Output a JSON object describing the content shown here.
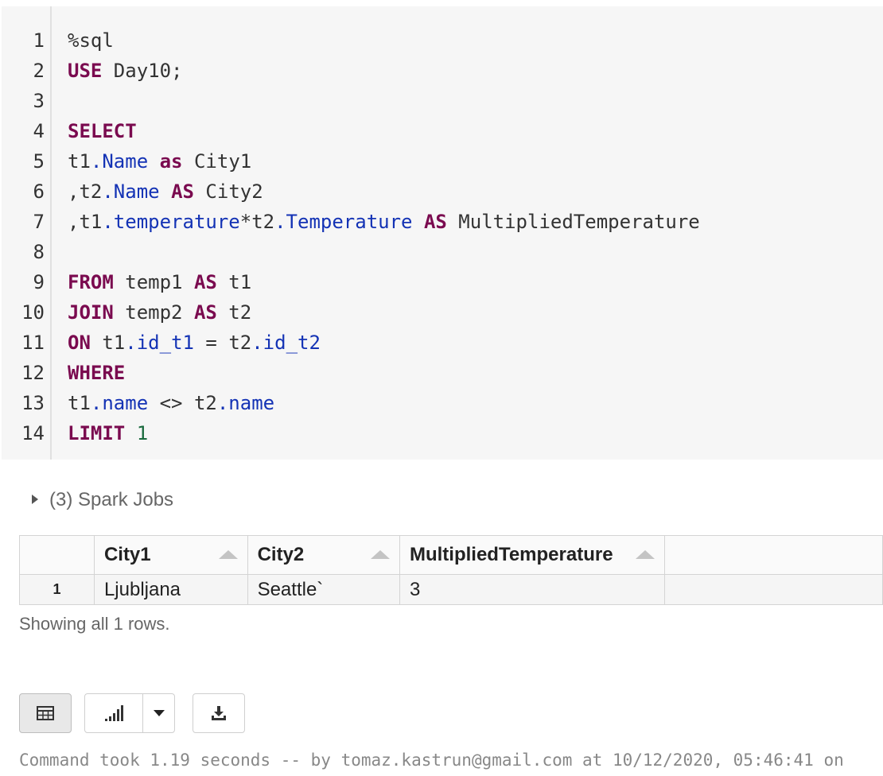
{
  "editor": {
    "lines": [
      {
        "num": "1",
        "tokens": [
          {
            "t": "%sql",
            "c": "plain"
          }
        ]
      },
      {
        "num": "2",
        "tokens": [
          {
            "t": "USE",
            "c": "kw"
          },
          {
            "t": " Day10;",
            "c": "plain"
          }
        ]
      },
      {
        "num": "3",
        "tokens": []
      },
      {
        "num": "4",
        "tokens": [
          {
            "t": "SELECT",
            "c": "kw"
          }
        ]
      },
      {
        "num": "5",
        "tokens": [
          {
            "t": "t1",
            "c": "plain"
          },
          {
            "t": ".Name",
            "c": "prop"
          },
          {
            "t": " ",
            "c": "plain"
          },
          {
            "t": "as",
            "c": "kw"
          },
          {
            "t": " City1",
            "c": "plain"
          }
        ]
      },
      {
        "num": "6",
        "tokens": [
          {
            "t": ",t2",
            "c": "plain"
          },
          {
            "t": ".Name",
            "c": "prop"
          },
          {
            "t": " ",
            "c": "plain"
          },
          {
            "t": "AS",
            "c": "kw"
          },
          {
            "t": " City2",
            "c": "plain"
          }
        ]
      },
      {
        "num": "7",
        "tokens": [
          {
            "t": ",t1",
            "c": "plain"
          },
          {
            "t": ".temperature",
            "c": "prop"
          },
          {
            "t": "*t2",
            "c": "plain"
          },
          {
            "t": ".Temperature",
            "c": "prop"
          },
          {
            "t": " ",
            "c": "plain"
          },
          {
            "t": "AS",
            "c": "kw"
          },
          {
            "t": " MultipliedTemperature",
            "c": "plain"
          }
        ]
      },
      {
        "num": "8",
        "tokens": []
      },
      {
        "num": "9",
        "tokens": [
          {
            "t": "FROM",
            "c": "kw"
          },
          {
            "t": " temp1 ",
            "c": "plain"
          },
          {
            "t": "AS",
            "c": "kw"
          },
          {
            "t": " t1",
            "c": "plain"
          }
        ]
      },
      {
        "num": "10",
        "tokens": [
          {
            "t": "JOIN",
            "c": "kw"
          },
          {
            "t": " temp2 ",
            "c": "plain"
          },
          {
            "t": "AS",
            "c": "kw"
          },
          {
            "t": " t2",
            "c": "plain"
          }
        ]
      },
      {
        "num": "11",
        "tokens": [
          {
            "t": "ON",
            "c": "kw"
          },
          {
            "t": " t1",
            "c": "plain"
          },
          {
            "t": ".id_t1",
            "c": "prop"
          },
          {
            "t": " = t2",
            "c": "plain"
          },
          {
            "t": ".id_t2",
            "c": "prop"
          }
        ]
      },
      {
        "num": "12",
        "tokens": [
          {
            "t": "WHERE",
            "c": "kw"
          }
        ]
      },
      {
        "num": "13",
        "tokens": [
          {
            "t": "t1",
            "c": "plain"
          },
          {
            "t": ".name",
            "c": "prop"
          },
          {
            "t": " <> t2",
            "c": "plain"
          },
          {
            "t": ".name",
            "c": "prop"
          }
        ]
      },
      {
        "num": "14",
        "tokens": [
          {
            "t": "LIMIT",
            "c": "kw"
          },
          {
            "t": " ",
            "c": "plain"
          },
          {
            "t": "1",
            "c": "num"
          }
        ]
      }
    ]
  },
  "spark_jobs": {
    "label": "(3) Spark Jobs"
  },
  "results": {
    "columns": [
      "City1",
      "City2",
      "MultipliedTemperature"
    ],
    "rows": [
      {
        "index": "1",
        "cells": [
          "Ljubljana",
          "Seattle`",
          "3"
        ]
      }
    ],
    "summary": "Showing all 1 rows."
  },
  "toolbar": {
    "icons": [
      "table-icon",
      "bar-chart-icon",
      "chevron-down-icon",
      "download-icon"
    ]
  },
  "footer": {
    "text": "Command took 1.19 seconds -- by tomaz.kastrun@gmail.com at 10/12/2020, 05:46:41 on"
  }
}
